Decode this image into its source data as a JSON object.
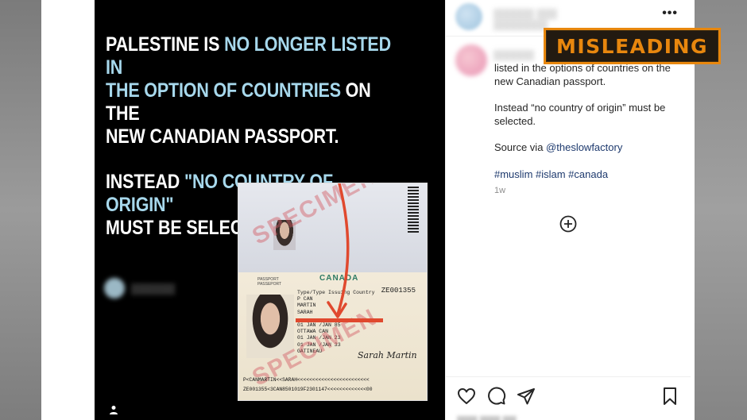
{
  "badge": {
    "label": "MISLEADING",
    "color": "#E8870E"
  },
  "media": {
    "headline_1": {
      "a": "PALESTINE IS ",
      "b": "NO LONGER LISTED IN",
      "c": "THE OPTION OF COUNTRIES",
      "d": " ON THE",
      "e": "NEW CANADIAN PASSPORT."
    },
    "headline_2": {
      "a": "INSTEAD ",
      "b": "\"NO COUNTRY OF ORIGIN\"",
      "c": "MUST BE SELECTED."
    },
    "highlight_color": "#A7D8EC",
    "user_icon": "user-icon"
  },
  "passport": {
    "specimen_1": "SPECIMEN",
    "specimen_2": "SPECIMEN",
    "country": "CANADA",
    "label": "PASSPORT\nPASSEPORT",
    "number": "ZE001355",
    "fields": [
      "Type/Type  Issuing Country",
      "P        CAN",
      "MARTIN",
      "SARAH",
      "",
      "01 JAN /JAN 85",
      "OTTAWA CAN",
      "01 JAN /JAN 23",
      "01 JAN /JAN 33",
      "GATINEAU"
    ],
    "signature": "Sarah Martin",
    "mrz_1": "P<CANMARTIN<<SARAH<<<<<<<<<<<<<<<<<<<<<<<<",
    "mrz_2": "ZE001355<3CAN8501019F2301147<<<<<<<<<<<<<00"
  },
  "panel": {
    "caption": [
      "listed in the options of countries on the new Canadian passport.",
      "Instead “no country of origin” must be selected."
    ],
    "source_prefix": "Source via ",
    "source_link": "@theslowfactory",
    "hashtags": "#muslim #islam #canada",
    "time": "1w",
    "icons": [
      "more-options-icon",
      "add-comment-icon",
      "heart-icon",
      "comment-icon",
      "share-icon",
      "save-icon"
    ]
  }
}
